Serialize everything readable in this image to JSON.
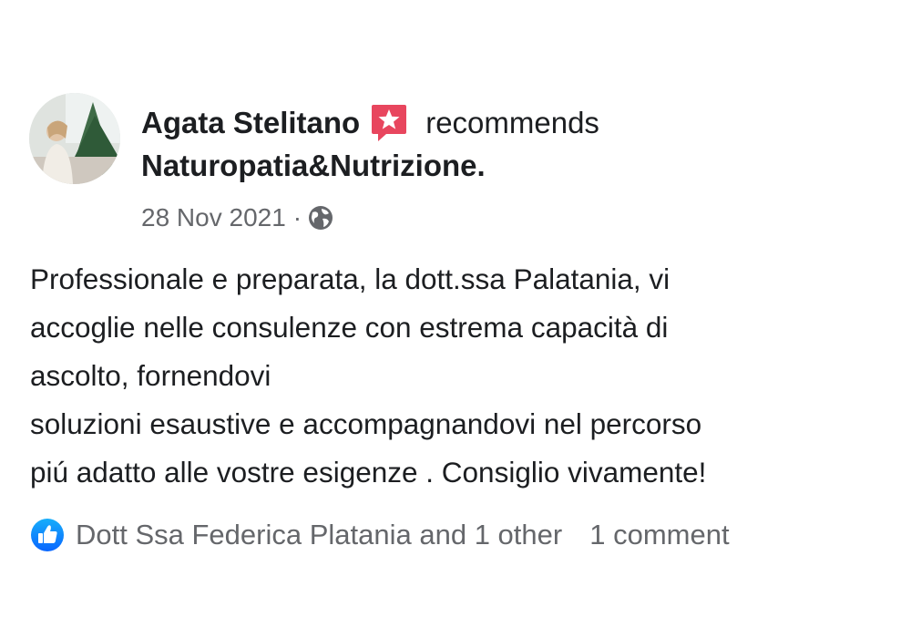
{
  "post": {
    "author": "Agata Stelitano",
    "action": "recommends",
    "page_name": "Naturopatia&Nutrizione",
    "page_name_suffix": ".",
    "date": "28 Nov 2021",
    "separator": "·",
    "audience_icon": "globe-icon",
    "recommend_icon": "recommend-star-icon",
    "body_lines": [
      "Professionale e preparata, la dott.ssa Palatania, vi",
      "accoglie nelle consulenze con estrema capacità di",
      "ascolto, fornendovi",
      "soluzioni esaustive e accompagnandovi nel percorso",
      "piú adatto alle vostre esigenze . Consiglio vivamente!"
    ]
  },
  "footer": {
    "reaction_icon": "like-icon",
    "reactors": "Dott Ssa Federica Platania and 1 other",
    "comments": "1 comment"
  },
  "colors": {
    "text_primary": "#1c1e21",
    "text_secondary": "#65676b",
    "recommend_badge": "#e8465e",
    "like_blue": "#1877f2"
  }
}
